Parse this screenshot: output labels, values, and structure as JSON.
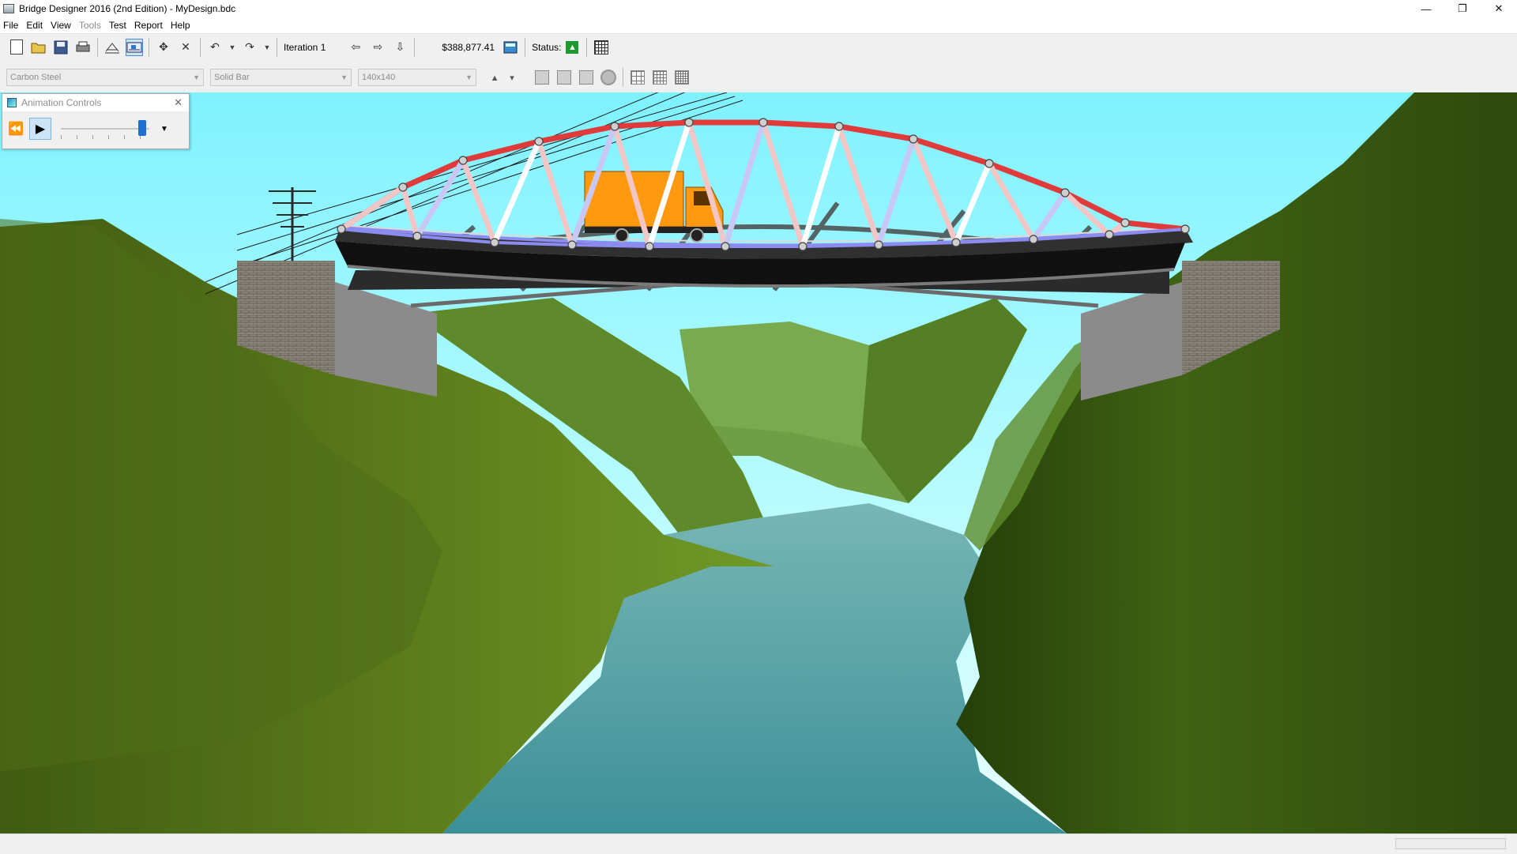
{
  "window": {
    "title": "Bridge Designer 2016 (2nd Edition) - MyDesign.bdc",
    "controls": [
      "—",
      "❐",
      "✕"
    ]
  },
  "menu": {
    "items": [
      {
        "label": "File",
        "enabled": true
      },
      {
        "label": "Edit",
        "enabled": true
      },
      {
        "label": "View",
        "enabled": true
      },
      {
        "label": "Tools",
        "enabled": false
      },
      {
        "label": "Test",
        "enabled": true
      },
      {
        "label": "Report",
        "enabled": true
      },
      {
        "label": "Help",
        "enabled": true
      }
    ]
  },
  "toolbar": {
    "iteration_label": "Iteration 1",
    "cost_label": "$388,877.41",
    "status_label": "Status:"
  },
  "properties": {
    "material": "Carbon Steel",
    "section": "Solid Bar",
    "size": "140x140"
  },
  "animation_controls": {
    "title": "Animation Controls",
    "speed_level": 0.92
  },
  "colors": {
    "sky_top": "#7fefff",
    "sky_bottom": "#cffcff",
    "compression": "#e03a3a",
    "tension": "#8c8cf0",
    "truck": "#ff9a10",
    "river": "#4a9aa0",
    "hill": "#4d6a18",
    "status_ok": "#1b9a2e"
  }
}
